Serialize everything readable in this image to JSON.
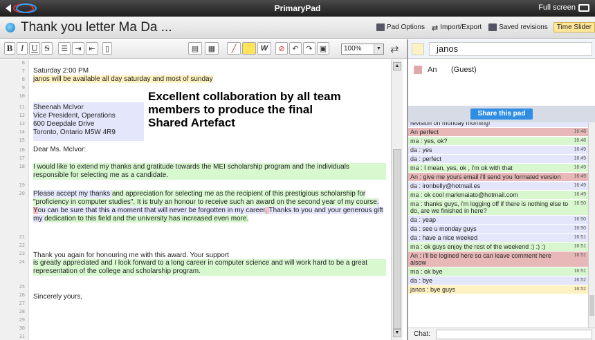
{
  "titlebar": {
    "title": "PrimaryPad",
    "fullscreen": "Full screen"
  },
  "pad": {
    "title": "Thank you letter Ma    Da       ..."
  },
  "header_buttons": {
    "pad_options": "Pad Options",
    "import_export": "Import/Export",
    "saved_revisions": "Saved revisions",
    "time_slider": "Time Slider"
  },
  "toolbar": {
    "bold": "B",
    "italic": "I",
    "underline": "U",
    "strike": "S",
    "zoom": "100%"
  },
  "gutter": [
    "6",
    "7",
    "8",
    "9",
    "10",
    "11",
    "12",
    "13",
    "14",
    "15",
    "16",
    "17",
    "18",
    "19",
    "20",
    "21",
    "22",
    "23",
    "24",
    "25",
    "26",
    "27",
    "28",
    "29",
    "30",
    "31"
  ],
  "doc": {
    "l7": "Saturday 2:00 PM",
    "l8": "janos will be available all day saturday and most of sunday",
    "l11": "Sheenah McIvor",
    "l12": "Vice President, Operations",
    "l13": "600 Deepdale Drive",
    "l14": "Toronto, Ontario M5W 4R9",
    "l16": "Dear Ms. McIvor:",
    "l18": "I would like to extend my thanks and gratitude towards the MEI scholarship program and the individuals responsible for selecting me as a candidate.",
    "l20a": "Please accept my thanks ",
    "l20b": "and appreciation for selecting me as the recipient of this prestigious scholarship for \"proficiency in computer studies\". It is truly an honour to receive such an award on the second year of my course",
    "l20c": ". ",
    "l20d": "Y",
    "l20e": "ou can be sure that this a moment that will never be forgotten in my career",
    "l20f": ". ",
    "l20g": "Thanks to you and your generous gift my ",
    "l20h": "dedication to this field and the university has increased even more.",
    "l23": "Thank you again for honouring me with this award.  Your support",
    "l24": "is greatly appreciated and I look forward to a long career in computer science and will work hard to be a great representation of the college and scholarship program.",
    "l27": "Sincerely yours,"
  },
  "overlay": [
    "Excellent collaboration by all team",
    "members to produce the final",
    "Shared Artefact"
  ],
  "users": {
    "me": "janos",
    "guest_name": "An",
    "guest_role": "(Guest)"
  },
  "share_label": "Share this pad",
  "chat": [
    {
      "who": "",
      "text": "revision on monday morning!",
      "time": "",
      "color": "bg-blue"
    },
    {
      "who": "An",
      "text": "perfect",
      "time": "16:48",
      "color": "bg-pink"
    },
    {
      "who": "ma",
      "text": ": yes, ok?",
      "time": "16:48",
      "color": "bg-green"
    },
    {
      "who": "da",
      "text": ": yes",
      "time": "16:49",
      "color": "bg-blue"
    },
    {
      "who": "da",
      "text": ": perfect",
      "time": "16:49",
      "color": "bg-blue"
    },
    {
      "who": "ma",
      "text": ": I mean, yes, ok , i'm ok with that",
      "time": "16:49",
      "color": "bg-green"
    },
    {
      "who": "An",
      "text": ": give me yours email i'll send you formated version",
      "time": "16:49",
      "color": "bg-pink"
    },
    {
      "who": "da",
      "text": ": ironbelly@hotmail.es",
      "time": "16:49",
      "color": "bg-blue"
    },
    {
      "who": "ma",
      "text": ": ok cool markmaiato@hotmail.com",
      "time": "16:49",
      "color": "bg-green"
    },
    {
      "who": "ma",
      "text": ": thanks guys, i'm logging off if there is nothing else to do, are we finished in here?",
      "time": "16:50",
      "color": "bg-green"
    },
    {
      "who": "da",
      "text": ": yeap",
      "time": "16:50",
      "color": "bg-blue"
    },
    {
      "who": "da",
      "text": ": see u monday guys",
      "time": "16:50",
      "color": "bg-blue"
    },
    {
      "who": "da",
      "text": ": have a nice weeked",
      "time": "16:51",
      "color": "bg-blue"
    },
    {
      "who": "ma",
      "text": ": ok guys enjoy the rest of the weekend :) :) :)",
      "time": "16:51",
      "color": "bg-green"
    },
    {
      "who": "An",
      "text": ": i'll be logined here so can leave comment here alsow",
      "time": "16:51",
      "color": "bg-pink"
    },
    {
      "who": "ma",
      "text": ": ok bye",
      "time": "16:51",
      "color": "bg-green"
    },
    {
      "who": "da",
      "text": ": bye",
      "time": "16:52",
      "color": "bg-blue"
    },
    {
      "who": "janos",
      "text": ": bye guys",
      "time": "16:52",
      "color": "bg-yellow"
    }
  ],
  "chat_label": "Chat:"
}
